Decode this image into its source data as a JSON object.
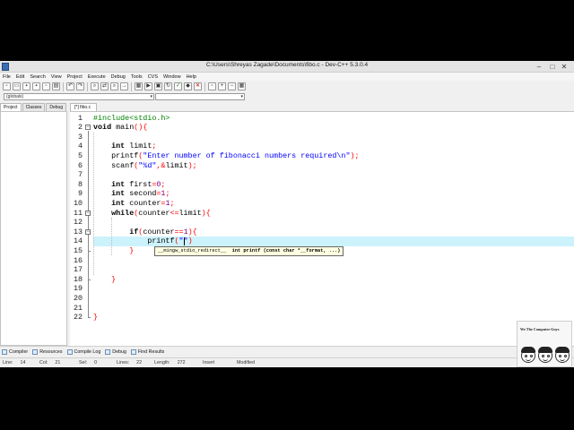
{
  "window": {
    "title": "C:\\Users\\Shreyas Zagade\\Documents\\fibo.c - Dev-C++ 5.3.0.4",
    "minimize": "–",
    "maximize": "□",
    "close": "✕"
  },
  "menu": [
    "File",
    "Edit",
    "Search",
    "View",
    "Project",
    "Execute",
    "Debug",
    "Tools",
    "CVS",
    "Window",
    "Help"
  ],
  "toolbar_icons": [
    "new-file-icon",
    "open-icon",
    "save-icon",
    "save-all-icon",
    "close-icon",
    "print-icon",
    "undo-icon",
    "redo-icon",
    "find-icon",
    "replace-icon",
    "find-next-icon",
    "goto-icon",
    "compile-icon",
    "run-icon",
    "compile-run-icon",
    "rebuild-icon",
    "check-icon",
    "debug-icon",
    "stop-icon",
    "new-project-icon",
    "add-icon",
    "remove-icon",
    "options-icon"
  ],
  "globals": {
    "selected": "(globals)",
    "members": ""
  },
  "left_tabs": [
    "Project",
    "Classes",
    "Debug"
  ],
  "editor_tab": "[*] fibo.c",
  "code": {
    "line_numbers": [
      "1",
      "2",
      "3",
      "4",
      "5",
      "6",
      "7",
      "8",
      "9",
      "10",
      "11",
      "12",
      "13",
      "14",
      "15",
      "16",
      "17",
      "18",
      "19",
      "20",
      "21",
      "22"
    ],
    "current_line": 14,
    "lines": [
      [
        [
          "pp",
          "#include<stdio.h>"
        ]
      ],
      [
        [
          "kw",
          "void"
        ],
        [
          "plain",
          " main"
        ],
        [
          "br",
          "()"
        ],
        [
          "br",
          "{"
        ]
      ],
      [],
      [
        [
          "plain",
          "    "
        ],
        [
          "kw",
          "int"
        ],
        [
          "plain",
          " limit"
        ],
        [
          "op",
          ";"
        ]
      ],
      [
        [
          "plain",
          "    printf"
        ],
        [
          "br",
          "("
        ],
        [
          "str",
          "\"Enter number of fibonacci numbers required\\n\""
        ],
        [
          "br",
          ")"
        ],
        [
          "op",
          ";"
        ]
      ],
      [
        [
          "plain",
          "    scanf"
        ],
        [
          "br",
          "("
        ],
        [
          "str",
          "\"%d\""
        ],
        [
          "op",
          ",&"
        ],
        [
          "plain",
          "limit"
        ],
        [
          "br",
          ")"
        ],
        [
          "op",
          ";"
        ]
      ],
      [],
      [
        [
          "plain",
          "    "
        ],
        [
          "kw",
          "int"
        ],
        [
          "plain",
          " first"
        ],
        [
          "op",
          "="
        ],
        [
          "num",
          "0"
        ],
        [
          "op",
          ";"
        ]
      ],
      [
        [
          "plain",
          "    "
        ],
        [
          "kw",
          "int"
        ],
        [
          "plain",
          " second"
        ],
        [
          "op",
          "="
        ],
        [
          "num",
          "1"
        ],
        [
          "op",
          ";"
        ]
      ],
      [
        [
          "plain",
          "    "
        ],
        [
          "kw",
          "int"
        ],
        [
          "plain",
          " counter"
        ],
        [
          "op",
          "="
        ],
        [
          "num",
          "1"
        ],
        [
          "op",
          ";"
        ]
      ],
      [
        [
          "plain",
          "    "
        ],
        [
          "kw",
          "while"
        ],
        [
          "br",
          "("
        ],
        [
          "plain",
          "counter"
        ],
        [
          "op",
          "<="
        ],
        [
          "plain",
          "limit"
        ],
        [
          "br",
          ")"
        ],
        [
          "br",
          "{"
        ]
      ],
      [],
      [
        [
          "plain",
          "        "
        ],
        [
          "kw",
          "if"
        ],
        [
          "br",
          "("
        ],
        [
          "plain",
          "counter"
        ],
        [
          "op",
          "=="
        ],
        [
          "num",
          "1"
        ],
        [
          "br",
          ")"
        ],
        [
          "br",
          "{"
        ]
      ],
      [
        [
          "plain",
          "            printf"
        ],
        [
          "br",
          "("
        ],
        [
          "str",
          "\"\""
        ],
        [
          "br",
          ")"
        ]
      ],
      [
        [
          "plain",
          "        "
        ],
        [
          "br",
          "}"
        ]
      ],
      [],
      [],
      [
        [
          "plain",
          "    "
        ],
        [
          "br",
          "}"
        ]
      ],
      [],
      [],
      [],
      [
        [
          "br",
          "}"
        ]
      ]
    ]
  },
  "tooltip": {
    "prefix": "__mingw_stdio_redirect__  ",
    "signature": "int printf (const char *__format, ...)"
  },
  "bottom_tabs": [
    "Compiler",
    "Resources",
    "Compile Log",
    "Debug",
    "Find Results"
  ],
  "status": {
    "line_label": "Line:",
    "line_value": "14",
    "col_label": "Col:",
    "col_value": "21",
    "sel_label": "Sel:",
    "sel_value": "0",
    "lines_label": "Lines:",
    "lines_value": "22",
    "length_label": "Length:",
    "length_value": "272",
    "mode": "Insert",
    "state": "Modified"
  },
  "logo": {
    "text": "We The Computer Guys"
  }
}
